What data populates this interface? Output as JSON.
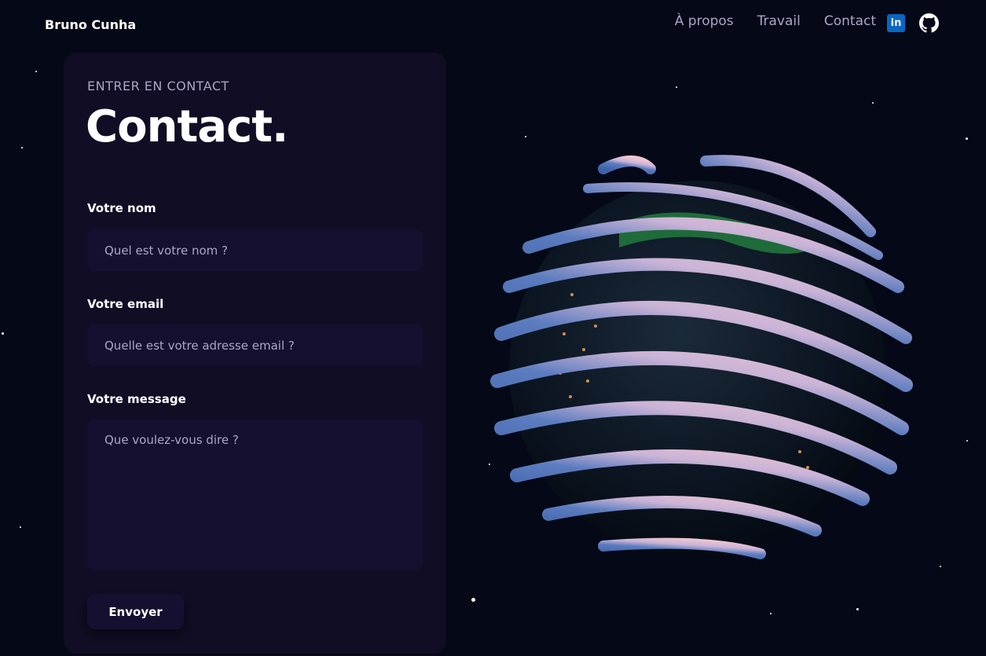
{
  "nav": {
    "brand": "Bruno Cunha",
    "links": [
      "À propos",
      "Travail",
      "Contact"
    ],
    "linkedin_label": "in",
    "icons": [
      "linkedin-icon",
      "github-icon"
    ]
  },
  "contact": {
    "eyebrow": "Entrer en contact",
    "title": "Contact.",
    "name_label": "Votre nom",
    "name_placeholder": "Quel est votre nom ?",
    "email_label": "Votre email",
    "email_placeholder": "Quelle est votre adresse email ?",
    "message_label": "Votre message",
    "message_placeholder": "Que voulez-vous dire ?",
    "submit_label": "Envoyer"
  },
  "colors": {
    "background": "#050816",
    "card": "#100d25",
    "field": "#151030",
    "secondary_text": "#aaa6c3"
  }
}
